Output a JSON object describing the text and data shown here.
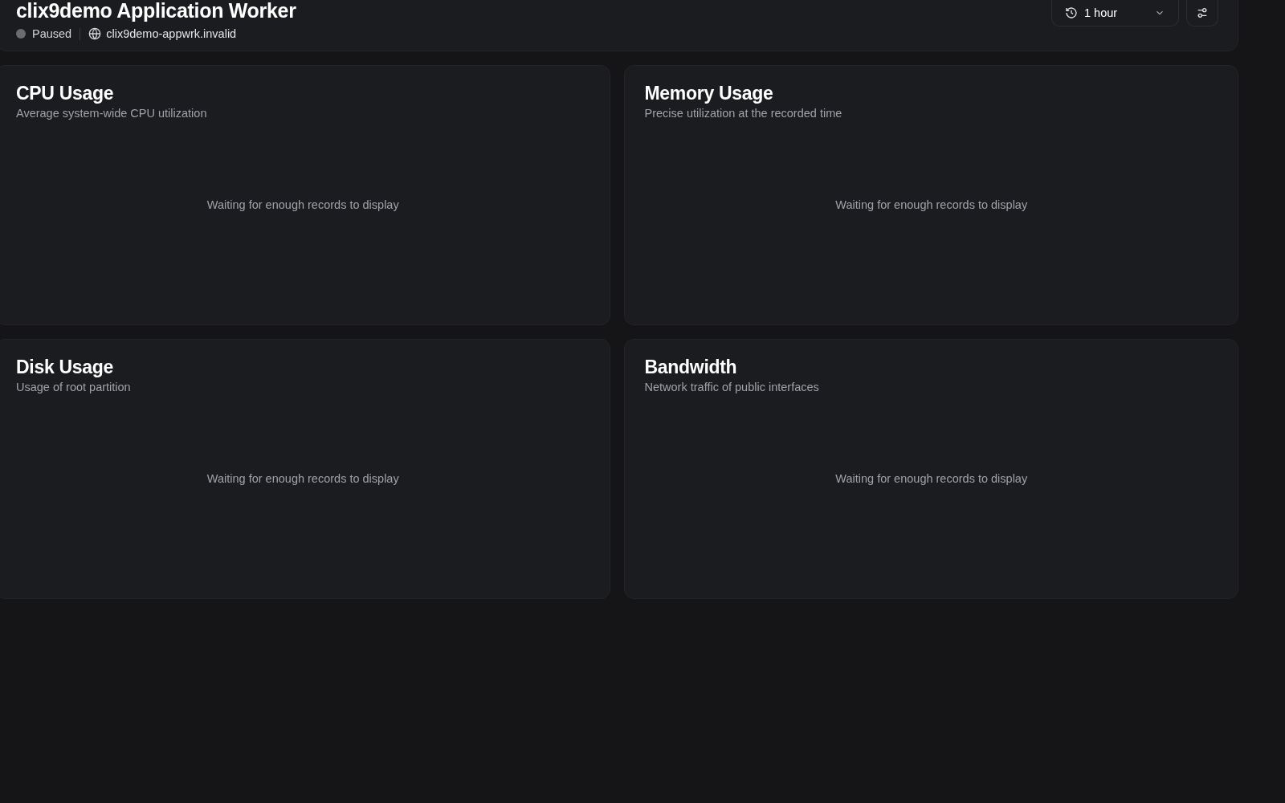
{
  "header": {
    "title": "clix9demo Application Worker",
    "status": "Paused",
    "host": "clix9demo-appwrk.invalid",
    "time_range": "1 hour"
  },
  "charts": [
    {
      "title": "CPU Usage",
      "description": "Average system-wide CPU utilization",
      "message": "Waiting for enough records to display"
    },
    {
      "title": "Memory Usage",
      "description": "Precise utilization at the recorded time",
      "message": "Waiting for enough records to display"
    },
    {
      "title": "Disk Usage",
      "description": "Usage of root partition",
      "message": "Waiting for enough records to display"
    },
    {
      "title": "Bandwidth",
      "description": "Network traffic of public interfaces",
      "message": "Waiting for enough records to display"
    }
  ]
}
